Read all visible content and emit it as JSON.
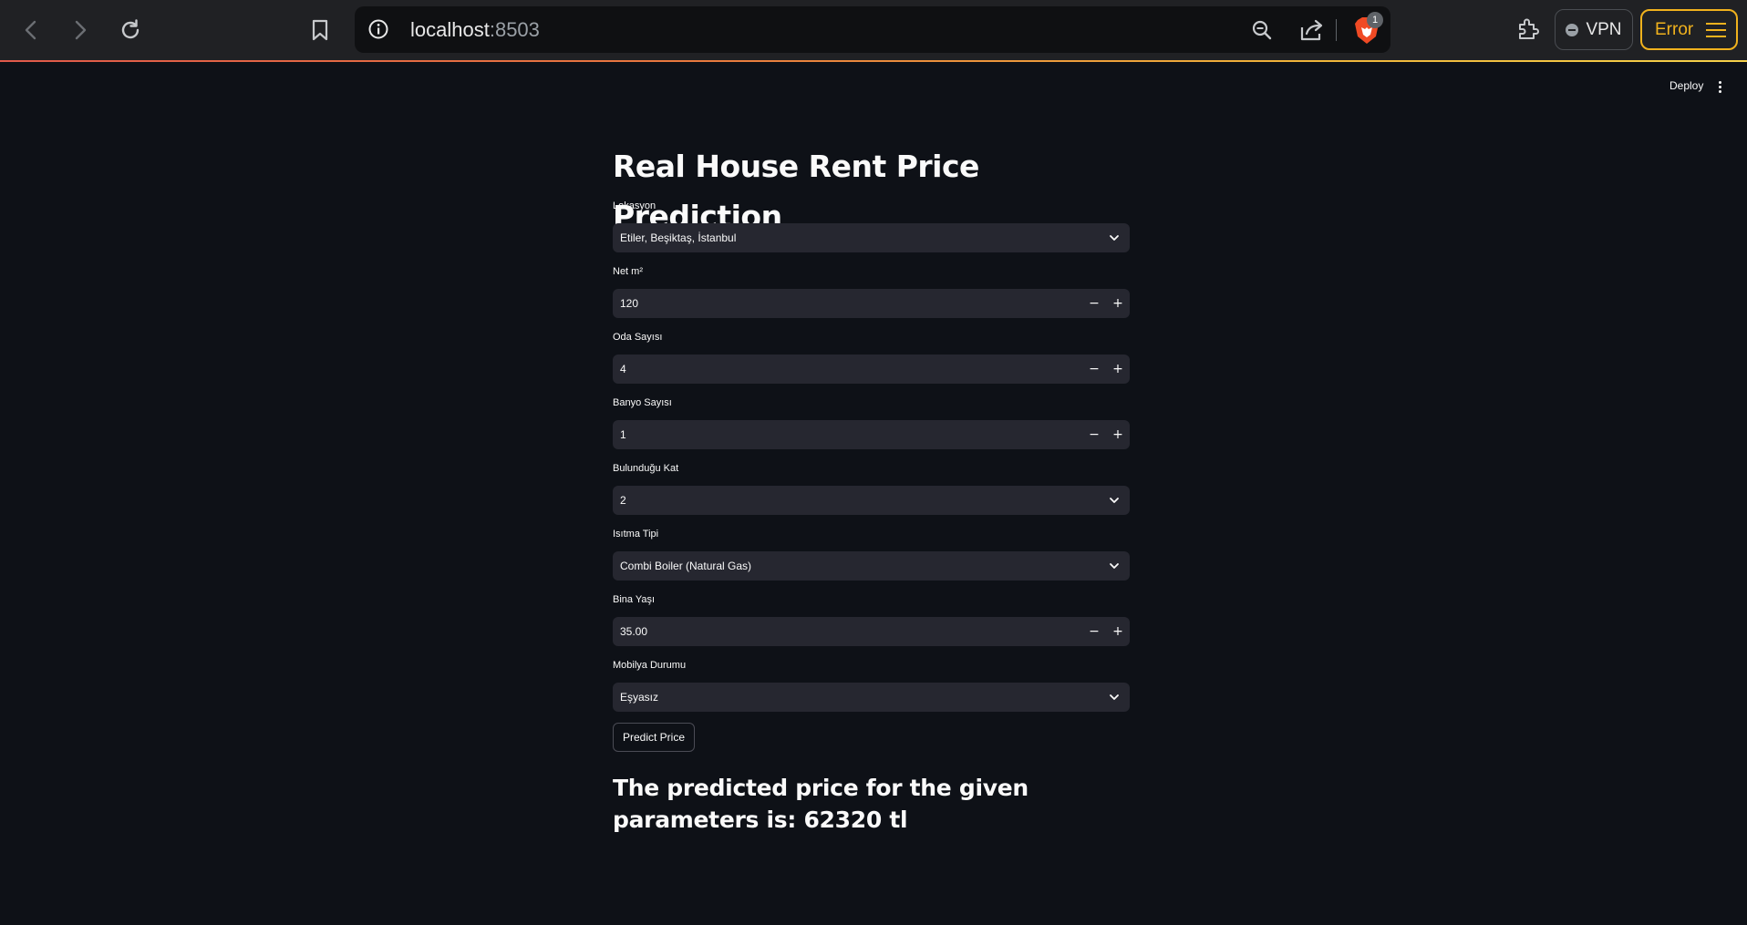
{
  "browser": {
    "url_host": "localhost",
    "url_port": ":8503",
    "shields_count": "1",
    "vpn_label": "VPN",
    "error_label": "Error"
  },
  "app": {
    "deploy_label": "Deploy",
    "title": "Real House Rent Price Prediction",
    "fields": {
      "location": {
        "label": "Lokasyon",
        "value": "Etiler, Beşiktaş, İstanbul"
      },
      "net_m2": {
        "label": "Net m²",
        "value": "120"
      },
      "rooms": {
        "label": "Oda Sayısı",
        "value": "4"
      },
      "bathrooms": {
        "label": "Banyo Sayısı",
        "value": "1"
      },
      "floor": {
        "label": "Bulunduğu Kat",
        "value": "2"
      },
      "heating": {
        "label": "Isıtma Tipi",
        "value": "Combi Boiler (Natural Gas)"
      },
      "building_age": {
        "label": "Bina Yaşı",
        "value": "35.00"
      },
      "furnishing": {
        "label": "Mobilya Durumu",
        "value": "Eşyasız"
      }
    },
    "predict_button": "Predict Price",
    "result_text": "The predicted price for the given parameters is: 62320 tl"
  },
  "colors": {
    "app_background": "#0e1117",
    "input_background": "#262730",
    "chrome_background": "#202124",
    "error_accent": "#f1b21d"
  },
  "icons": {
    "back": "back-arrow-icon",
    "forward": "forward-arrow-icon",
    "reload": "reload-icon",
    "bookmark": "bookmark-icon",
    "site_info": "info-icon",
    "zoom": "zoom-out-icon",
    "share": "share-icon",
    "shields": "brave-lion-icon",
    "extensions": "puzzle-icon",
    "menu": "hamburger-icon"
  }
}
